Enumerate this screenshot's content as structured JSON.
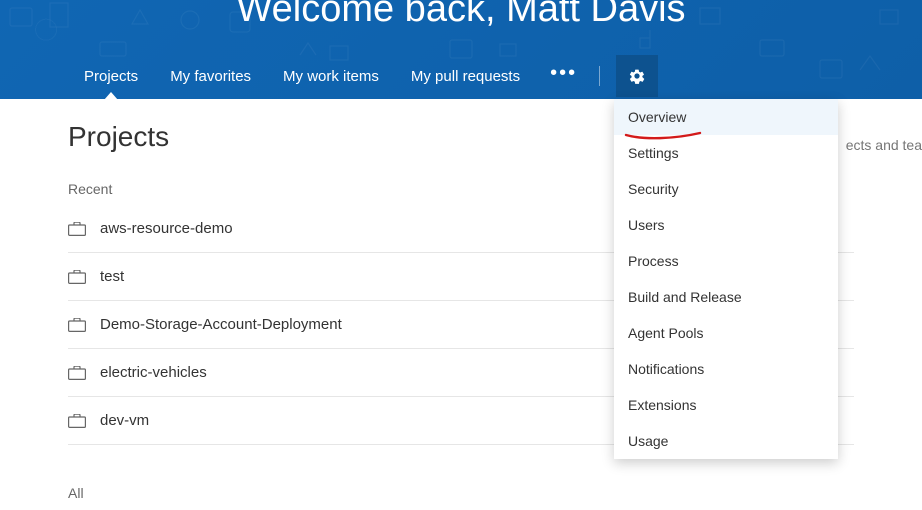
{
  "header": {
    "welcome_text": "Welcome back, Matt Davis",
    "tabs": [
      {
        "label": "Projects",
        "active": true
      },
      {
        "label": "My favorites",
        "active": false
      },
      {
        "label": "My work items",
        "active": false
      },
      {
        "label": "My pull requests",
        "active": false
      }
    ]
  },
  "page": {
    "title": "Projects",
    "recent_label": "Recent",
    "all_label": "All",
    "search_hint_fragment": "ects and tea"
  },
  "projects": [
    {
      "name": "aws-resource-demo"
    },
    {
      "name": "test"
    },
    {
      "name": "Demo-Storage-Account-Deployment"
    },
    {
      "name": "electric-vehicles"
    },
    {
      "name": "dev-vm"
    }
  ],
  "settings_menu": [
    {
      "label": "Overview",
      "highlighted": true,
      "annotated": true
    },
    {
      "label": "Settings"
    },
    {
      "label": "Security"
    },
    {
      "label": "Users"
    },
    {
      "label": "Process"
    },
    {
      "label": "Build and Release"
    },
    {
      "label": "Agent Pools"
    },
    {
      "label": "Notifications"
    },
    {
      "label": "Extensions"
    },
    {
      "label": "Usage"
    }
  ],
  "colors": {
    "header_bg": "#0e5fa8",
    "gear_bg": "#0d528f",
    "highlight_bg": "#eff6fc",
    "annotation": "#d31a1a"
  }
}
